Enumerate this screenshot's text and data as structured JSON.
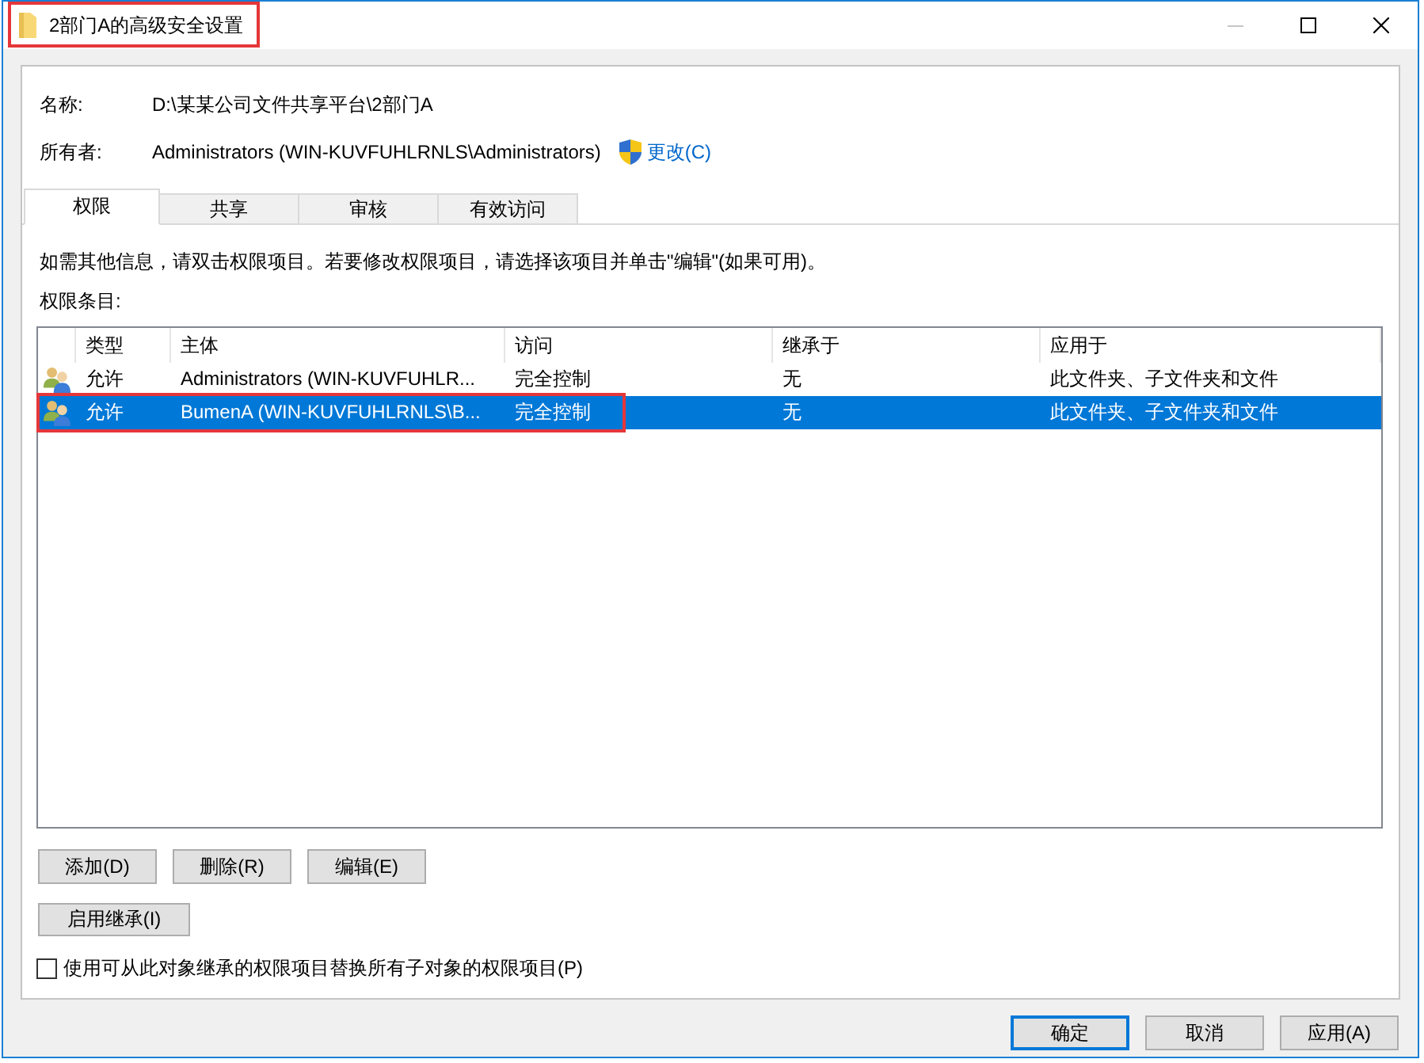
{
  "window": {
    "title": "2部门A的高级安全设置",
    "highlighted": true,
    "controls": [
      {
        "kind": "minimize",
        "disabled": true
      },
      {
        "kind": "maximize",
        "disabled": false
      },
      {
        "kind": "close",
        "disabled": false
      }
    ]
  },
  "details": [
    {
      "label": "名称:",
      "value": "D:\\某某公司文件共享平台\\2部门A"
    },
    {
      "label": "所有者:",
      "value": "Administrators (WIN-KUVFUHLRNLS\\Administrators)",
      "link": "更改(C)"
    }
  ],
  "tabs": [
    {
      "label": "权限",
      "selected": true
    },
    {
      "label": "共享",
      "selected": false
    },
    {
      "label": "审核",
      "selected": false
    },
    {
      "label": "有效访问",
      "selected": false
    }
  ],
  "info_text": "如需其他信息，请双击权限项目。若要修改权限项目，请选择该项目并单击\"编辑\"(如果可用)。",
  "entries_label": "权限条目:",
  "permission_list": {
    "columns": [
      "类型",
      "主体",
      "访问",
      "继承于",
      "应用于"
    ],
    "rows": [
      {
        "cells": [
          "允许",
          "Administrators (WIN-KUVFUHLR...",
          "完全控制",
          "无",
          "此文件夹、子文件夹和文件"
        ],
        "selected": false,
        "highlighted": false
      },
      {
        "cells": [
          "允许",
          "BumenA (WIN-KUVFUHLRNLS\\B...",
          "完全控制",
          "无",
          "此文件夹、子文件夹和文件"
        ],
        "selected": true,
        "highlighted": true
      }
    ]
  },
  "entry_buttons": [
    "添加(D)",
    "删除(R)",
    "编辑(E)"
  ],
  "inheritance_button": "启用继承(I)",
  "replace_checkbox": {
    "label": "使用可从此对象继承的权限项目替换所有子对象的权限项目(P)",
    "checked": false
  },
  "dialog_buttons": [
    {
      "label": "确定",
      "default": true
    },
    {
      "label": "取消",
      "default": false
    },
    {
      "label": "应用(A)",
      "default": false
    }
  ]
}
